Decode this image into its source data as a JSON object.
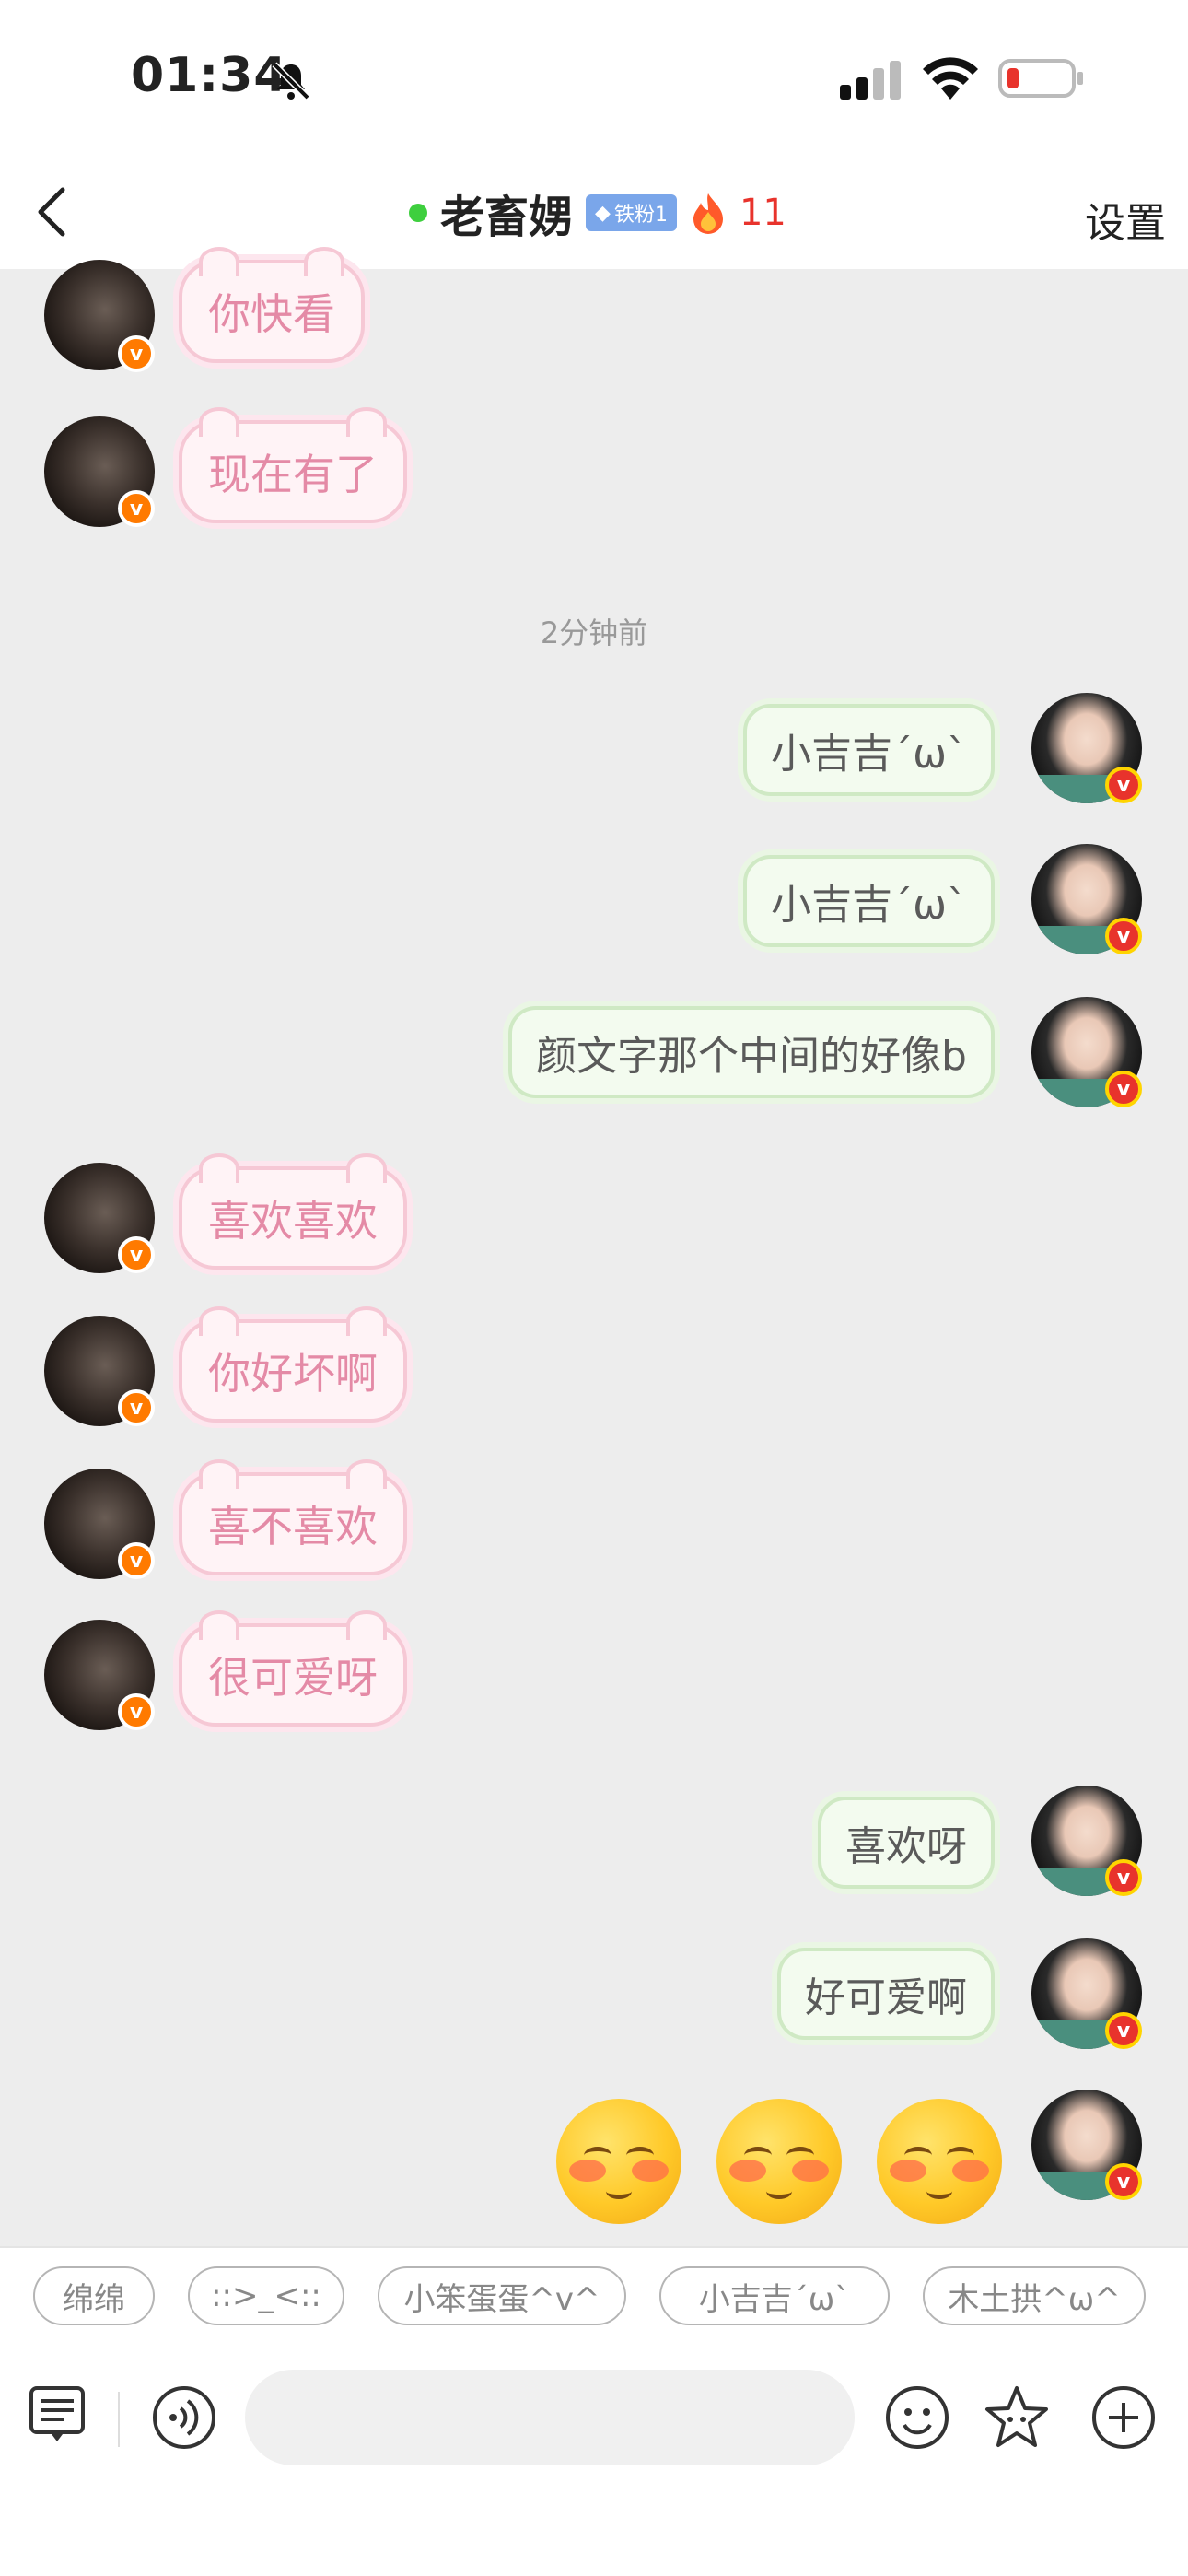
{
  "status_bar": {
    "time": "01:34"
  },
  "nav": {
    "title": "老畜娚",
    "fan_badge": "铁粉1",
    "fire_count": "11",
    "settings_label": "设置"
  },
  "timestamp": "2分钟前",
  "messages": [
    {
      "side": "left",
      "text": "你快看"
    },
    {
      "side": "left",
      "text": "现在有了"
    },
    {
      "side": "right",
      "text": "小吉吉´ω`"
    },
    {
      "side": "right",
      "text": "小吉吉´ω`"
    },
    {
      "side": "right",
      "text": "颜文字那个中间的好像b"
    },
    {
      "side": "left",
      "text": "喜欢喜欢"
    },
    {
      "side": "left",
      "text": "你好坏啊"
    },
    {
      "side": "left",
      "text": "喜不喜欢"
    },
    {
      "side": "left",
      "text": "很可爱呀"
    },
    {
      "side": "right",
      "text": "喜欢呀"
    },
    {
      "side": "right",
      "text": "好可爱啊"
    }
  ],
  "badge_letter": "v",
  "emoji_count": 3,
  "quick_replies": [
    "绵绵",
    "::>_<::",
    "小笨蛋蛋^v^",
    "小吉吉´ω`",
    "木土拱^ω^"
  ],
  "colors": {
    "accent_red": "#e8332c",
    "online_green": "#3ecf3e",
    "pink_bubble_text": "#e48aa6",
    "badge_orange": "#ff7a00"
  },
  "icons": [
    "back-chevron-icon",
    "bell-muted-icon",
    "signal-icon",
    "wifi-icon",
    "battery-icon",
    "fire-icon",
    "keyboard-icon",
    "voice-icon",
    "emoji-face-icon",
    "sticker-star-icon",
    "plus-icon"
  ]
}
